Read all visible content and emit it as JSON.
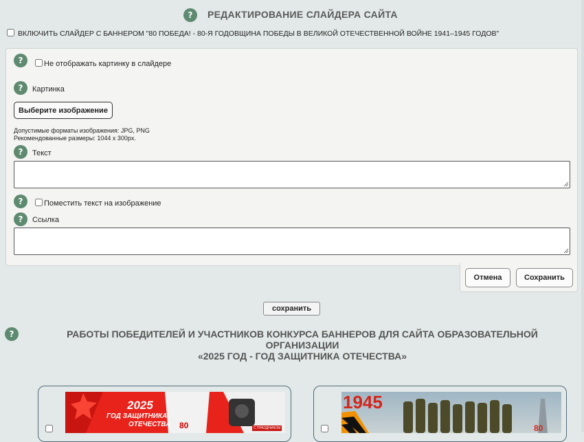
{
  "header": {
    "title": "РЕДАКТИРОВАНИЕ СЛАЙДЕРА САЙТА",
    "help": "?"
  },
  "enable_slider": {
    "label": "ВКЛЮЧИТЬ СЛАЙДЕР С БАННЕРОМ \"80 ПОБЕДА! - 80-Я ГОДОВЩИНА ПОБЕДЫ В ВЕЛИКОЙ ОТЕЧЕСТВЕННОЙ ВОЙНЕ 1941–1945 ГОДОВ\"",
    "checked": false
  },
  "form": {
    "hide_image_label": "Не отображать картинку в слайдере",
    "image_label": "Картинка",
    "choose_image_button": "Выберите изображение",
    "formats_note": "Допустимые форматы изображения: JPG, PNG",
    "size_note": "Рекомендованные размеры: 1044 x 300px.",
    "text_label": "Текст",
    "text_value": "",
    "overlay_text_label": "Поместить текст на изображение",
    "link_label": "Ссылка",
    "link_value": ""
  },
  "actions": {
    "cancel": "Отмена",
    "save": "Сохранить"
  },
  "save_small": "сохранить",
  "contest": {
    "title_line1": "РАБОТЫ ПОБЕДИТЕЛЕЙ И УЧАСТНИКОВ КОНКУРСА БАННЕРОВ ДЛЯ САЙТА ОБРАЗОВАТЕЛЬНОЙ ОРГАНИЗАЦИИ",
    "title_line2": "«2025 ГОД - ГОД ЗАЩИТНИКА ОТЕЧЕСТВА»"
  },
  "banners": [
    {
      "year": "2025",
      "line1": "ГОД ЗАЩИТНИКА",
      "line2": "ОТЕЧЕСТВА",
      "badge": "80",
      "tag": "С ПРАЗДНИКОМ"
    },
    {
      "year": "1945",
      "badge": "80"
    }
  ],
  "colors": {
    "background": "#e2e9e8",
    "help_badge": "#5e8a70",
    "banner1_red": "#e8231c"
  }
}
